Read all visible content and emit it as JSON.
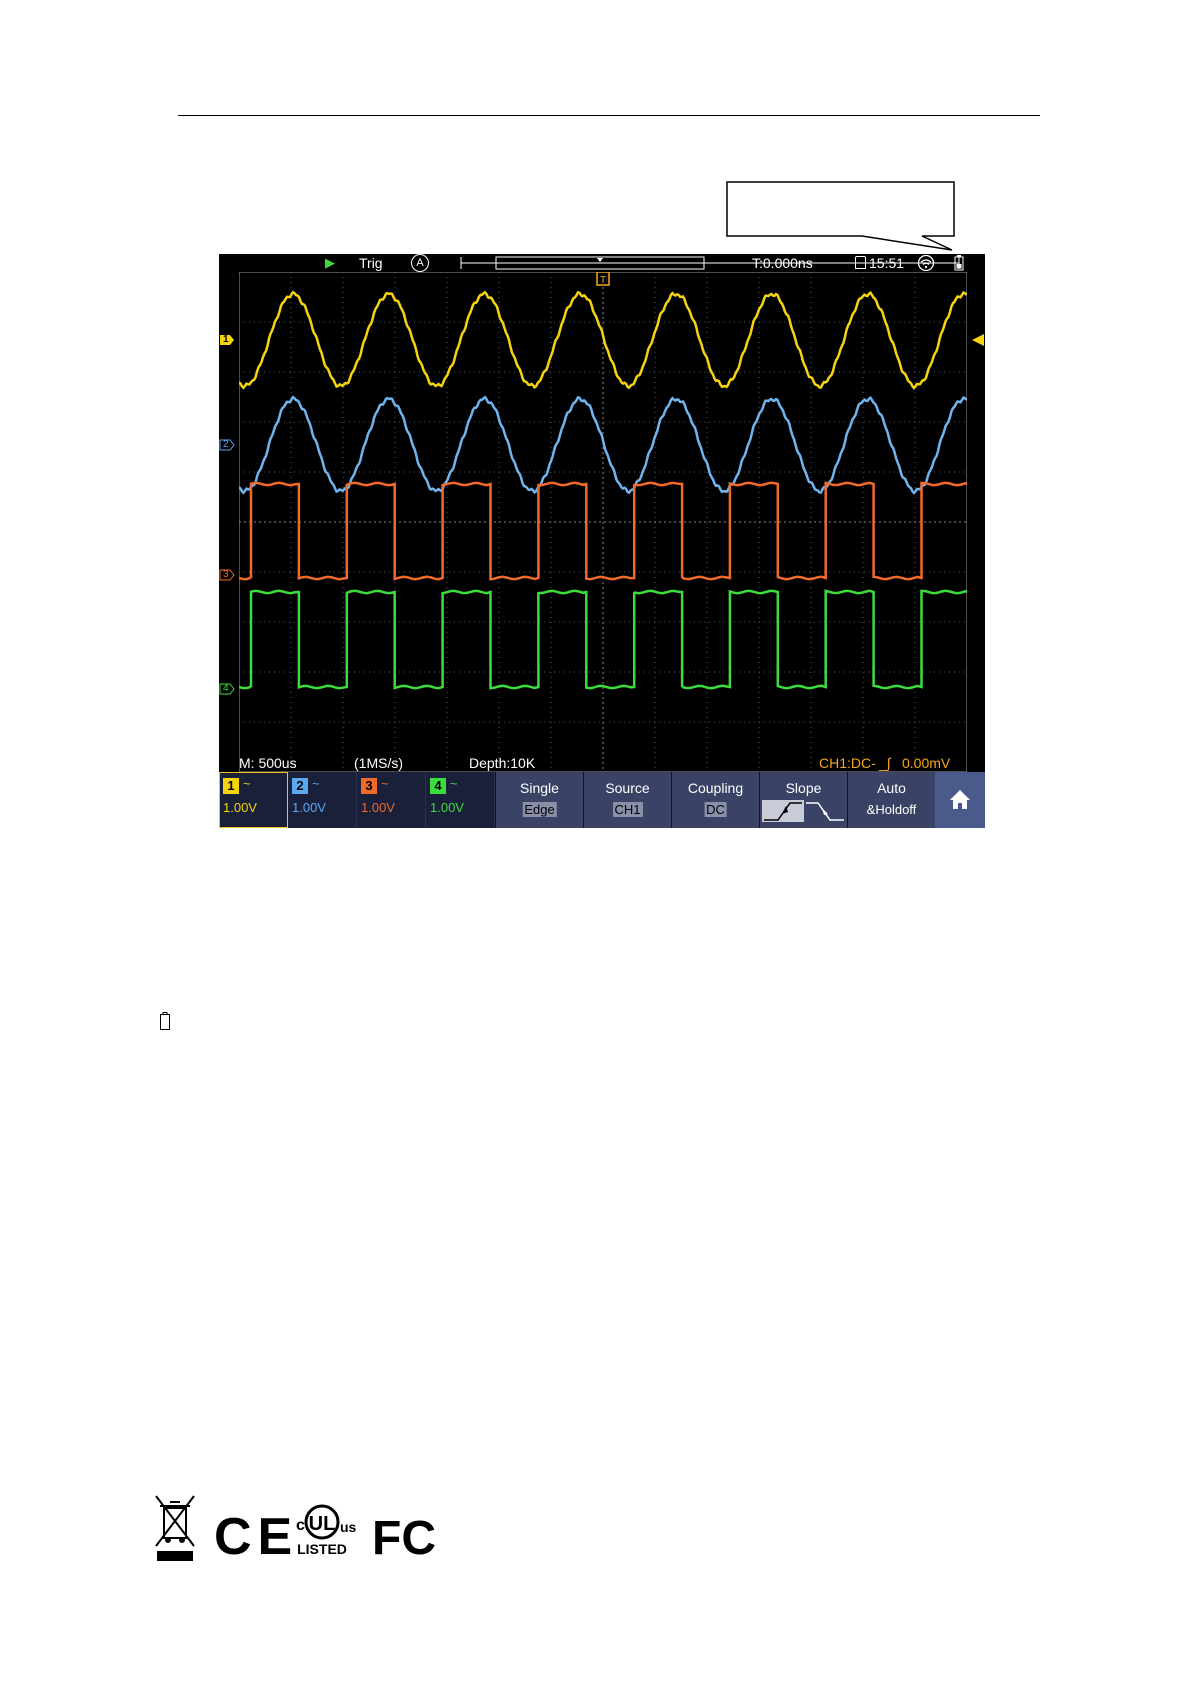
{
  "status_bar": {
    "run_state": "Trig",
    "auto_mode": "A",
    "trigger_time": "T:0.000ns",
    "clock": "15:51"
  },
  "bottom_info": {
    "timebase": "M: 500us",
    "sample_rate": "(1MS/s)",
    "depth": "Depth:10K",
    "trigger_info": "CH1:DC-",
    "trigger_level": "0.00mV"
  },
  "channels": [
    {
      "num": "1",
      "coupling": "~",
      "volts": "1.00V",
      "color": "#f5d40f"
    },
    {
      "num": "2",
      "coupling": "~",
      "volts": "1.00V",
      "color": "#5aa9f0"
    },
    {
      "num": "3",
      "coupling": "~",
      "volts": "1.00V",
      "color": "#f06a2a"
    },
    {
      "num": "4",
      "coupling": "~",
      "volts": "1.00V",
      "color": "#3ddc3d"
    }
  ],
  "menu": [
    {
      "label": "Single",
      "value": "Edge"
    },
    {
      "label": "Source",
      "value": "CH1"
    },
    {
      "label": "Coupling",
      "value": "DC"
    },
    {
      "label": "Slope",
      "value": ""
    },
    {
      "label": "Auto",
      "value": "&Holdoff"
    }
  ],
  "markers": {
    "ch1": "1",
    "ch2": "2",
    "ch3": "3",
    "ch4": "4",
    "trigger": "T"
  },
  "icons": [
    "run-icon",
    "auto-icon",
    "lock-icon",
    "wifi-icon",
    "battery-icon",
    "home-icon",
    "slope-rising-icon",
    "slope-falling-icon"
  ],
  "logos": {
    "ce": "CE",
    "ul_c": "c",
    "ul": "UL",
    "ul_us": "us",
    "ul_listed": "LISTED",
    "fcc": "FC"
  }
}
